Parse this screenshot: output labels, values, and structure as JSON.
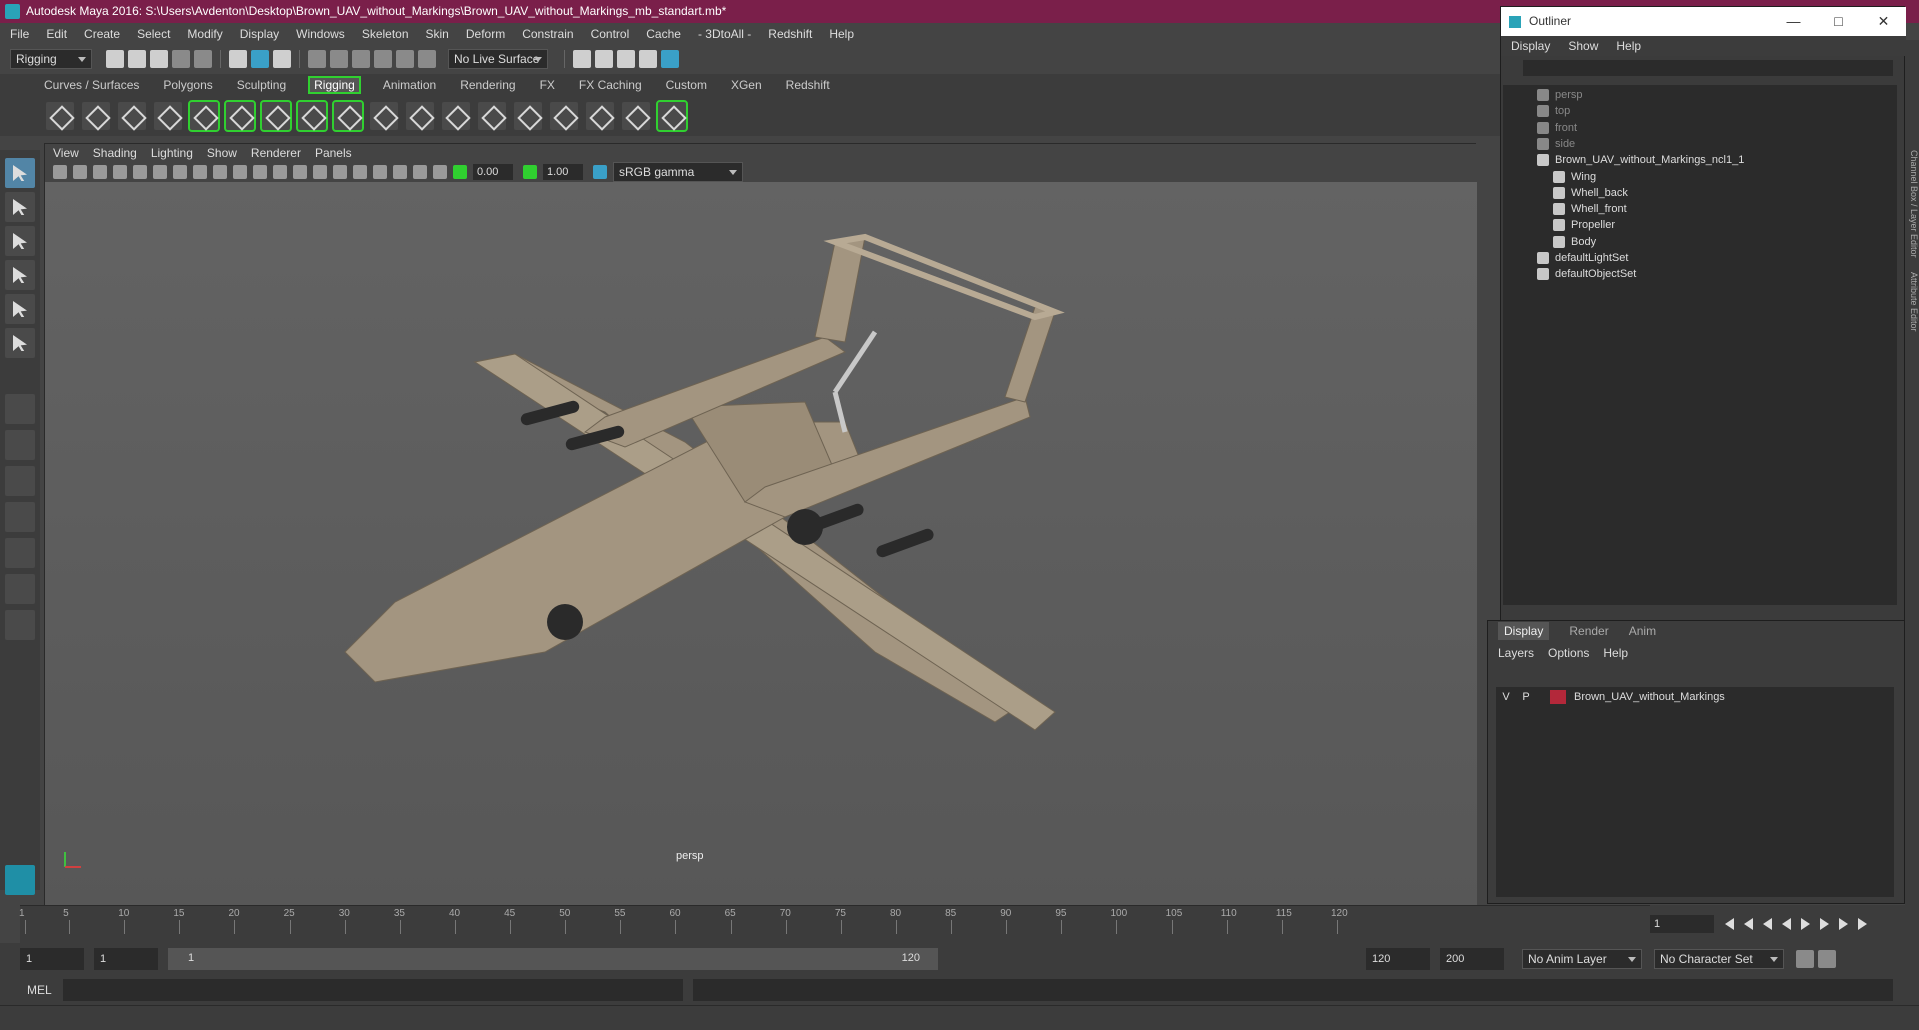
{
  "window": {
    "title": "Autodesk Maya 2016: S:\\Users\\Avdenton\\Desktop\\Brown_UAV_without_Markings\\Brown_UAV_without_Markings_mb_standart.mb*"
  },
  "menu": [
    "File",
    "Edit",
    "Create",
    "Select",
    "Modify",
    "Display",
    "Windows",
    "Skeleton",
    "Skin",
    "Deform",
    "Constrain",
    "Control",
    "Cache",
    "- 3DtoAll -",
    "Redshift",
    "Help"
  ],
  "status": {
    "mode": "Rigging",
    "live_surface": "No Live Surface"
  },
  "shelf": {
    "tabs": [
      "Curves / Surfaces",
      "Polygons",
      "Sculpting",
      "Rigging",
      "Animation",
      "Rendering",
      "FX",
      "FX Caching",
      "Custom",
      "XGen",
      "Redshift"
    ],
    "active": "Rigging"
  },
  "viewport": {
    "menu": [
      "View",
      "Shading",
      "Lighting",
      "Show",
      "Renderer",
      "Panels"
    ],
    "exposure": "0.00",
    "gamma": "1.00",
    "color_space": "sRGB gamma",
    "camera": "persp"
  },
  "outliner": {
    "title": "Outliner",
    "menu": [
      "Display",
      "Show",
      "Help"
    ],
    "items": [
      {
        "label": "persp",
        "dim": true,
        "indent": 1
      },
      {
        "label": "top",
        "dim": true,
        "indent": 1
      },
      {
        "label": "front",
        "dim": true,
        "indent": 1
      },
      {
        "label": "side",
        "dim": true,
        "indent": 1
      },
      {
        "label": "Brown_UAV_without_Markings_ncl1_1",
        "dim": false,
        "indent": 1
      },
      {
        "label": "Wing",
        "dim": false,
        "indent": 2
      },
      {
        "label": "Whell_back",
        "dim": false,
        "indent": 2
      },
      {
        "label": "Whell_front",
        "dim": false,
        "indent": 2
      },
      {
        "label": "Propeller",
        "dim": false,
        "indent": 2
      },
      {
        "label": "Body",
        "dim": false,
        "indent": 2
      },
      {
        "label": "defaultLightSet",
        "dim": false,
        "indent": 1
      },
      {
        "label": "defaultObjectSet",
        "dim": false,
        "indent": 1
      }
    ]
  },
  "layers": {
    "tabs": [
      "Display",
      "Render",
      "Anim"
    ],
    "active_tab": "Display",
    "menu": [
      "Layers",
      "Options",
      "Help"
    ],
    "rows": [
      {
        "v": "V",
        "p": "P",
        "name": "Brown_UAV_without_Markings",
        "color": "#b3283a"
      }
    ]
  },
  "timeline": {
    "ticks": [
      1,
      5,
      10,
      15,
      20,
      25,
      30,
      35,
      40,
      45,
      50,
      55,
      60,
      65,
      70,
      75,
      80,
      85,
      90,
      95,
      100,
      105,
      110,
      115,
      120
    ],
    "current_frame": "1"
  },
  "range": {
    "start": "1",
    "playback_start": "1",
    "slider_start": "1",
    "slider_end": "120",
    "playback_end": "120",
    "end": "200",
    "anim_layer": "No Anim Layer",
    "character_set": "No Character Set"
  },
  "cmd": {
    "label": "MEL"
  },
  "side_tabs": [
    "Channel Box / Layer Editor",
    "Attribute Editor"
  ],
  "colors": {
    "title_bar": "#7a1f4a",
    "accent": "#30d030",
    "selection": "#5285a6"
  }
}
